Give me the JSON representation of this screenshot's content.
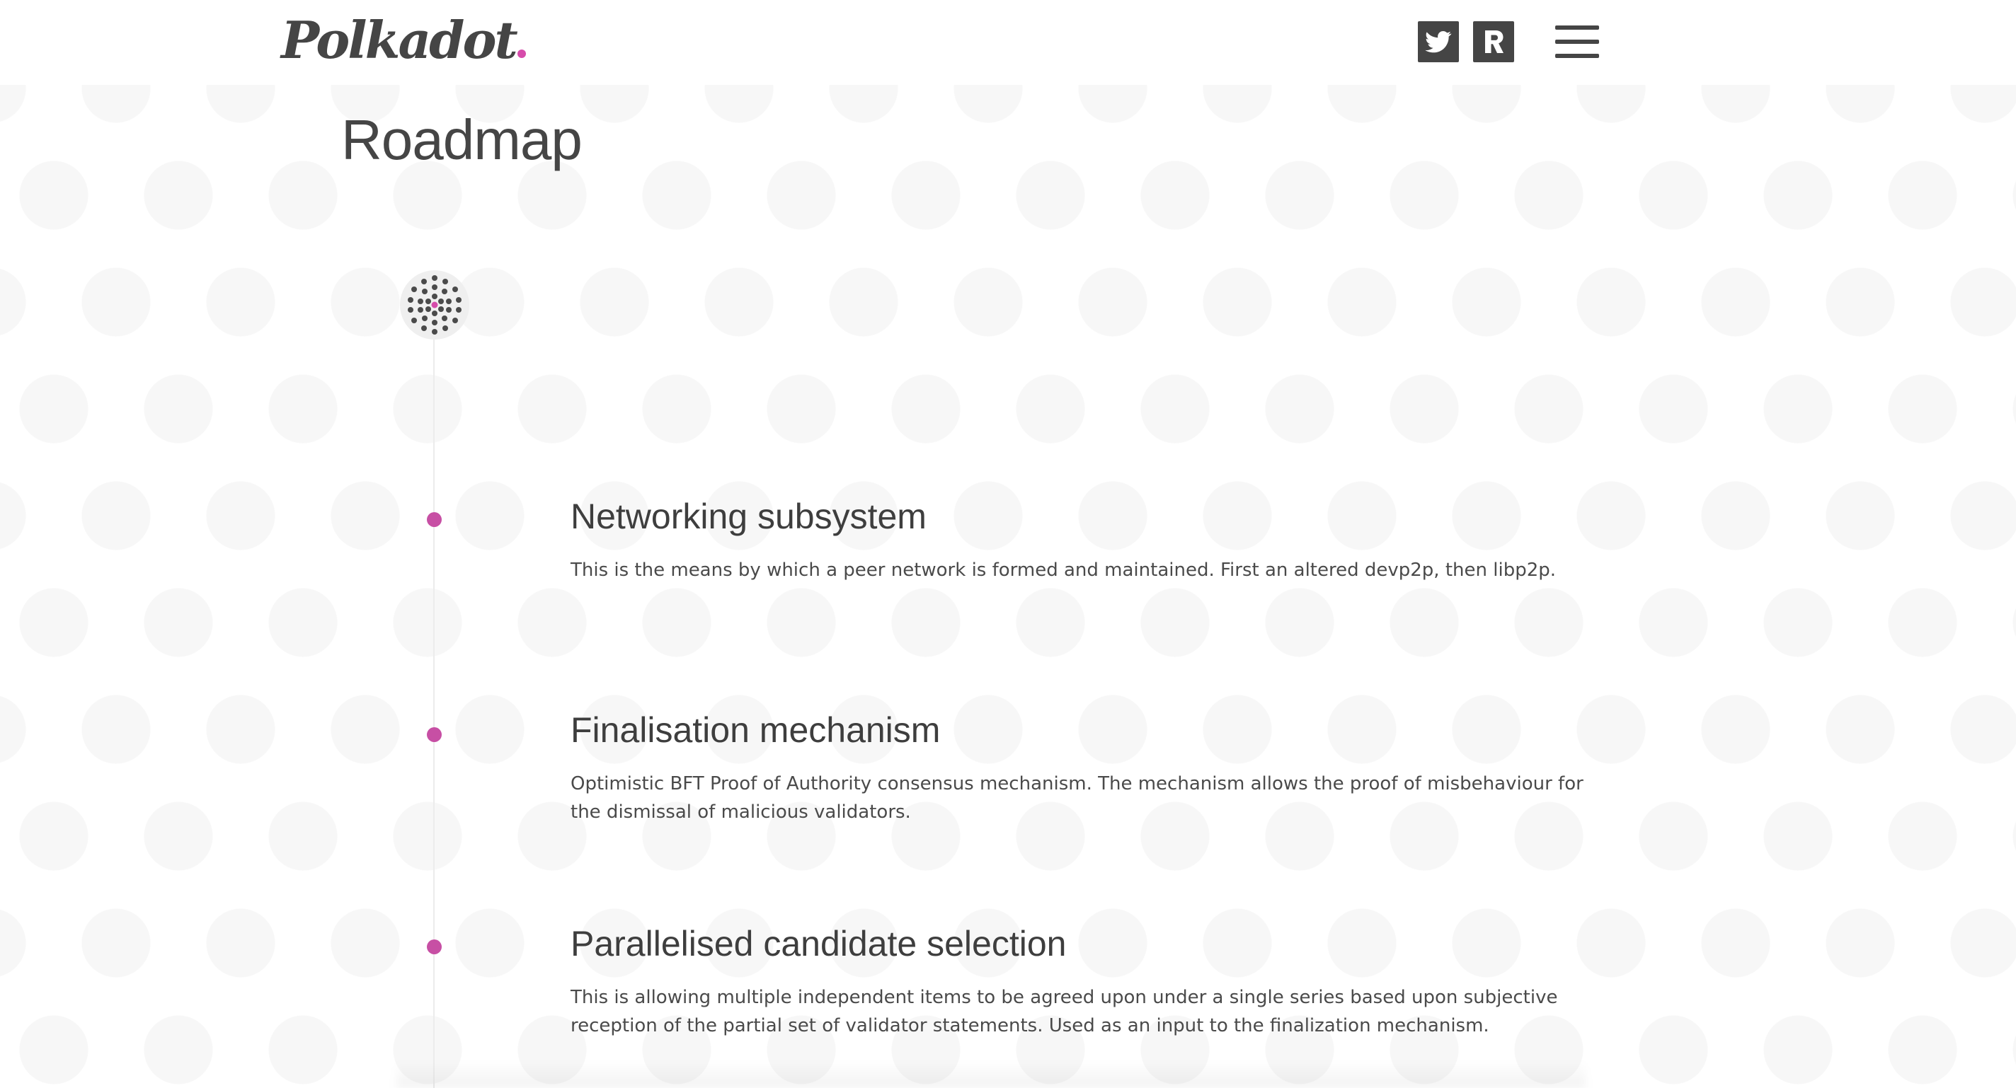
{
  "header": {
    "logo_text": "Polkadot",
    "logo_accent_color": "#d64cab",
    "social_links": [
      {
        "name": "twitter",
        "icon": "twitter-icon"
      },
      {
        "name": "riot",
        "icon": "riot-icon"
      }
    ],
    "menu_icon": "hamburger-menu-icon"
  },
  "page": {
    "title": "Roadmap"
  },
  "timeline": {
    "start_icon": "polkadot-dots-icon",
    "marker_color": "#c74fa4",
    "items": [
      {
        "title": "Networking subsystem",
        "description": "This is the means by which a peer network is formed and maintained. First an altered devp2p, then libp2p."
      },
      {
        "title": "Finalisation mechanism",
        "description": "Optimistic BFT Proof of Authority consensus mechanism. The mechanism allows the proof of misbehaviour for the dismissal of malicious validators."
      },
      {
        "title": "Parallelised candidate selection",
        "description": "This is allowing multiple independent items to be agreed upon under a single series based upon subjective reception of the partial set of validator statements. Used as an input to the finalization mechanism."
      }
    ]
  }
}
